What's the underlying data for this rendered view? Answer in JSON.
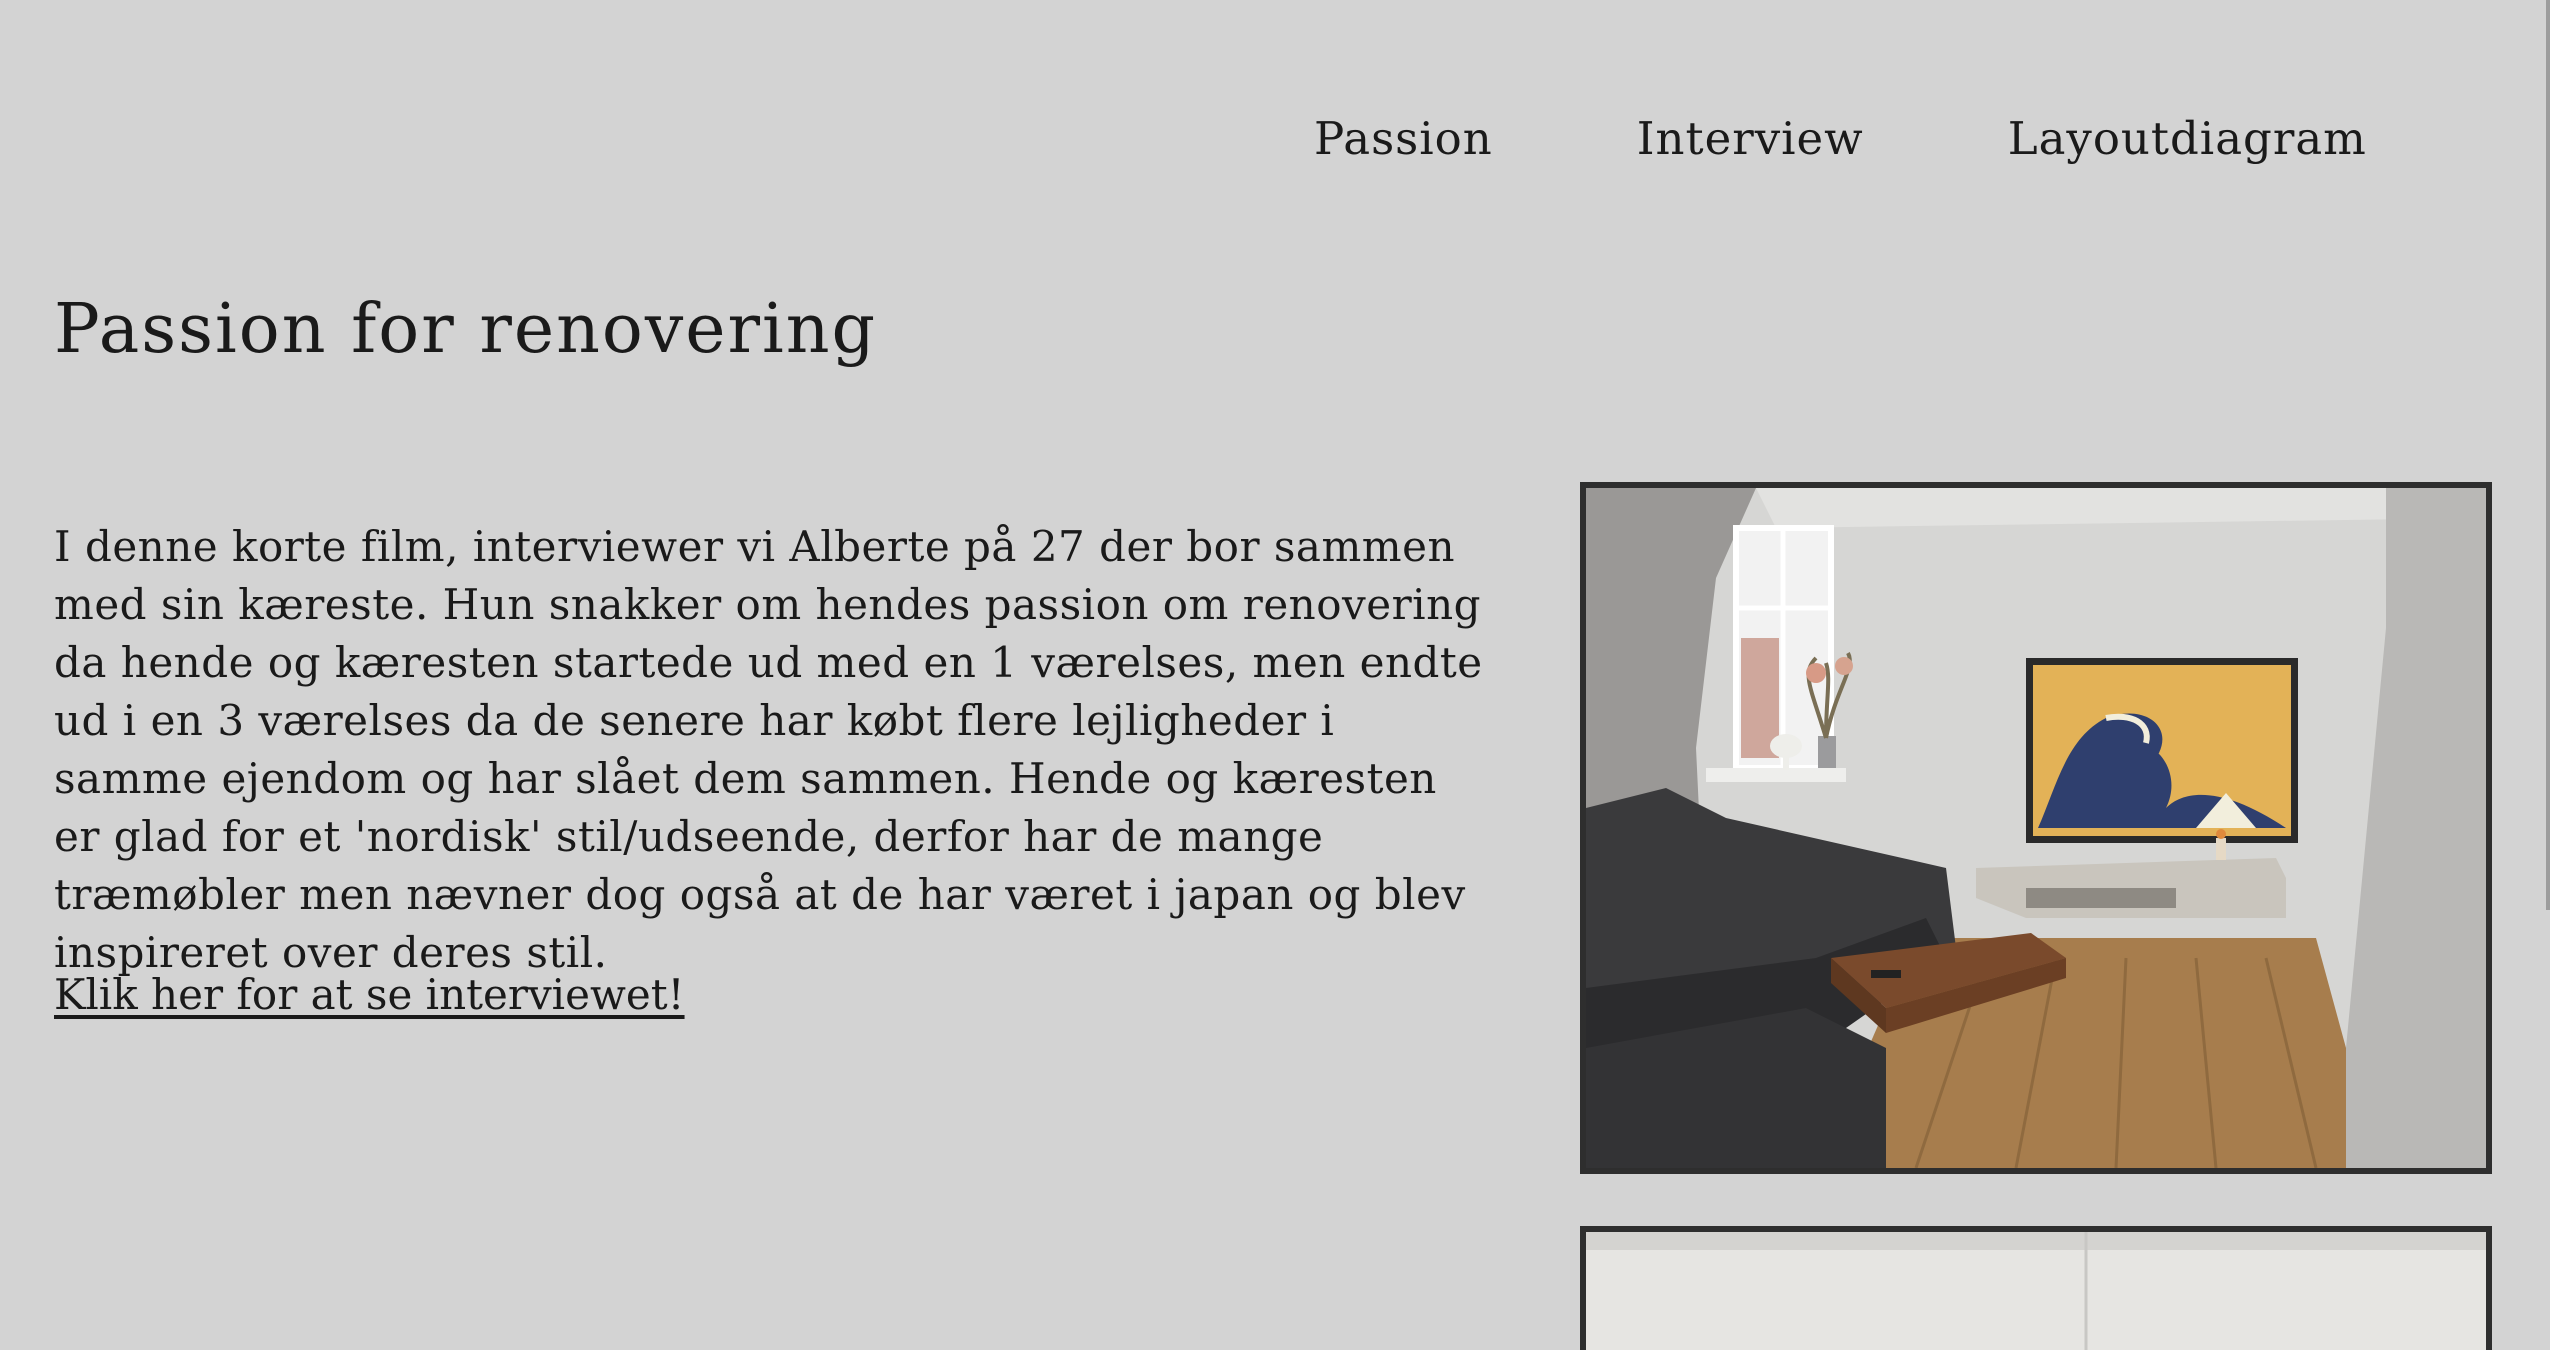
{
  "nav": {
    "items": [
      {
        "label": "Passion"
      },
      {
        "label": "Interview"
      },
      {
        "label": "Layoutdiagram"
      }
    ]
  },
  "main": {
    "title": "Passion for renovering",
    "intro": "I denne korte film, interviewer vi Alberte på 27 der bor sammen med sin kæreste. Hun snakker om hendes passion om renovering da hende og kæresten startede ud med en 1 værelses, men endte ud i en 3 værelses da de senere har købt flere lejligheder i samme ejendom og har slået dem sammen. Hende og kæresten er glad for et 'nordisk' stil/udseende, derfor har de mange træmøbler men nævner dog også at de har været i japan og blev inspireret over deres stil.",
    "cta_link": "Klik her for at se interviewet!"
  },
  "colors": {
    "background": "#d3d3d3",
    "text": "#1a1a1a",
    "photo_border": "#2e2e2e"
  }
}
